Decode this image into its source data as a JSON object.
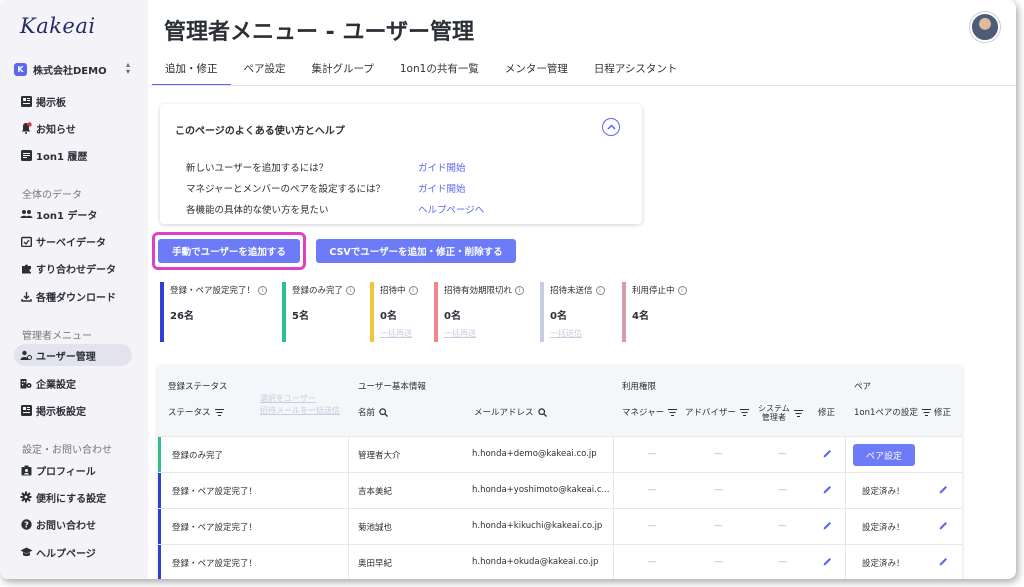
{
  "app": {
    "logo": "Kakeai",
    "company": "株式会社DEMO",
    "company_icon": "K"
  },
  "sidebar": {
    "top_items": [
      {
        "label": "掲示板",
        "icon": "board-icon"
      },
      {
        "label": "お知らせ",
        "icon": "bell-icon"
      },
      {
        "label": "1on1 履歴",
        "icon": "history-icon"
      }
    ],
    "section_data": "全体のデータ",
    "data_items": [
      {
        "label": "1on1 データ",
        "icon": "people-icon"
      },
      {
        "label": "サーベイデータ",
        "icon": "survey-icon"
      },
      {
        "label": "すり合わせデータ",
        "icon": "puzzle-icon"
      },
      {
        "label": "各種ダウンロード",
        "icon": "download-icon"
      }
    ],
    "section_admin": "管理者メニュー",
    "admin_items": [
      {
        "label": "ユーザー管理",
        "icon": "user-manage-icon",
        "active": true
      },
      {
        "label": "企業設定",
        "icon": "company-settings-icon"
      },
      {
        "label": "掲示板設定",
        "icon": "board-settings-icon"
      }
    ],
    "section_settings": "設定・お問い合わせ",
    "settings_items": [
      {
        "label": "プロフィール",
        "icon": "profile-icon"
      },
      {
        "label": "便利にする設定",
        "icon": "gear-icon"
      },
      {
        "label": "お問い合わせ",
        "icon": "question-icon"
      },
      {
        "label": "ヘルプページ",
        "icon": "graduation-cap-icon"
      }
    ]
  },
  "header": {
    "title": "管理者メニュー - ユーザー管理"
  },
  "tabs": [
    "追加・修正",
    "ペア設定",
    "集計グループ",
    "1on1の共有一覧",
    "メンター管理",
    "日程アシスタント"
  ],
  "help": {
    "title": "このページのよくある使い方とヘルプ",
    "rows": [
      {
        "question": "新しいユーザーを追加するには？",
        "link": "ガイド開始"
      },
      {
        "question": "マネジャーとメンバーのペアを設定するには？",
        "link": "ガイド開始"
      },
      {
        "question": "各機能の具体的な使い方を見たい",
        "link": "ヘルプページへ"
      }
    ]
  },
  "actions": {
    "manual_add": "手動でユーザーを追加する",
    "csv": "CSVでユーザーを追加・修正・削除する"
  },
  "stats": [
    {
      "label": "登録・ペア設定完了！",
      "value": "26名",
      "color": "#2f3fd6",
      "link": ""
    },
    {
      "label": "登録のみ完了",
      "value": "5名",
      "color": "#2fbf8a",
      "link": ""
    },
    {
      "label": "招待中",
      "value": "0名",
      "color": "#f2c53d",
      "link": "一括再送"
    },
    {
      "label": "招待有効期限切れ",
      "value": "0名",
      "color": "#f0868c",
      "link": "一括再送"
    },
    {
      "label": "招待未送信",
      "value": "0名",
      "color": "#c8cde0",
      "link": "一括送信"
    },
    {
      "label": "利用停止中",
      "value": "4名",
      "color": "#d0a0a8",
      "link": ""
    }
  ],
  "table": {
    "groups": {
      "status": "登録ステータス",
      "basic": "ユーザー基本情報",
      "perm": "利用権限",
      "pair": "ペア"
    },
    "headers": {
      "status": "ステータス",
      "name": "名前",
      "email": "メールアドレス",
      "manager": "マネジャー",
      "advisor": "アドバイザー",
      "sysadmin_1": "システム",
      "sysadmin_2": "管理者",
      "edit": "修正",
      "pair_setting": "1on1ペアの設定",
      "pair_edit": "修正"
    },
    "faded_links": [
      "選択をユーザー",
      "招待メールを一括送信"
    ],
    "rows": [
      {
        "status": "登録のみ完了",
        "status_color": "#2fbf8a",
        "name": "管理者大介",
        "email": "h.honda+demo@kakeai.co.jp",
        "pair": "ペア設定",
        "pair_button": true
      },
      {
        "status": "登録・ペア設定完了！",
        "status_color": "#2f3fd6",
        "name": "吉本美紀",
        "email": "h.honda+yoshimoto@kakeai.c...",
        "pair": "設定済み！",
        "pair_button": false
      },
      {
        "status": "登録・ペア設定完了！",
        "status_color": "#2f3fd6",
        "name": "菊池誠也",
        "email": "h.honda+kikuchi@kakeai.co.jp",
        "pair": "設定済み！",
        "pair_button": false
      },
      {
        "status": "登録・ペア設定完了！",
        "status_color": "#2f3fd6",
        "name": "奥田早紀",
        "email": "h.honda+okuda@kakeai.co.jp",
        "pair": "設定済み！",
        "pair_button": false
      }
    ],
    "dash": "—"
  },
  "colors": {
    "accent": "#5a67f2",
    "button": "#6d7bf7",
    "highlight": "#e040c6",
    "notification_dot": "#e0334a"
  }
}
